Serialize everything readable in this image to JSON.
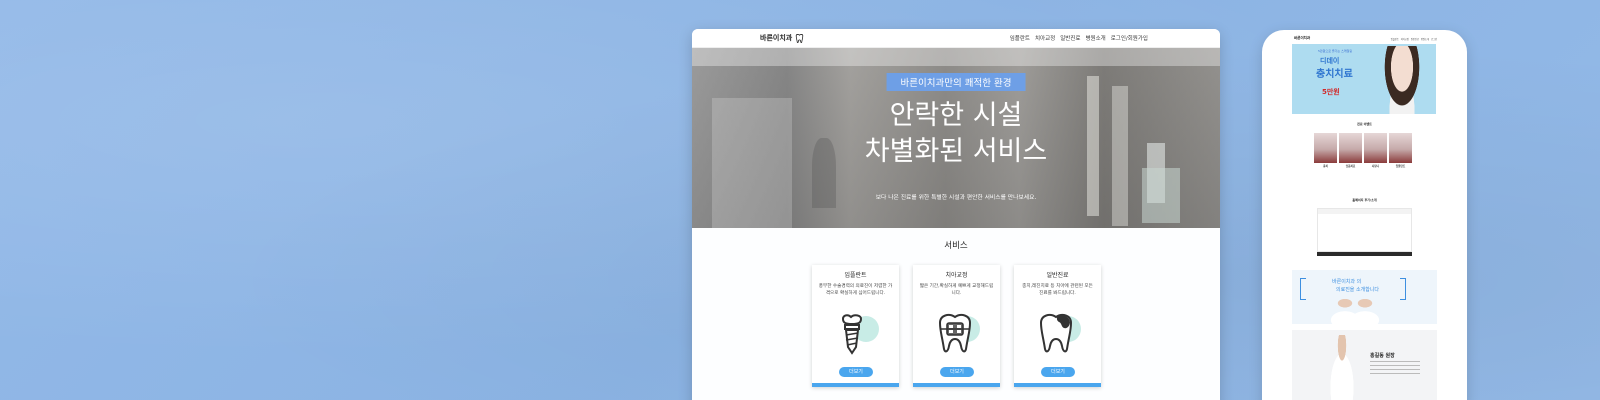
{
  "desktop": {
    "logo": "바른이치과",
    "nav": [
      "임플란트",
      "치아교정",
      "일반진료",
      "병원소개",
      "로그인/회원가입"
    ],
    "hero": {
      "badge": "바른이치과만의 쾌적한 환경",
      "title_line1": "안락한 시설",
      "title_line2": "차별화된 서비스",
      "subtitle": "보다 나은 진료를 위한 특별한 시설과 편안한 서비스를 만나보세요."
    },
    "services": {
      "title": "서비스",
      "cards": [
        {
          "name": "임플란트",
          "desc": "풍부한 수술경력의 의료진이 저렴한 가격으로 확실하게 심어드립니다.",
          "more": "더보기",
          "icon": "implant-icon"
        },
        {
          "name": "치아교정",
          "desc": "짧은 기간,확실하게 예쁘게 교정해드립니다.",
          "more": "더보기",
          "icon": "braces-tooth-icon"
        },
        {
          "name": "일반진료",
          "desc": "충치,레진치료 등 치아에 관련된 모든 진료를 봐드립니다.",
          "more": "더보기",
          "icon": "cavity-tooth-icon"
        }
      ]
    }
  },
  "mobile": {
    "logo": "바른이치과",
    "nav": [
      "임플란트",
      "치아교정",
      "일반진료",
      "병원소개",
      "로그인"
    ],
    "banner": {
      "tiny": "5만원으로 즐기는 스케일링",
      "big1": "디데이",
      "big2": "충치치료",
      "price": "5만원"
    },
    "section1_title": "진료 이벤트",
    "teeth_labels": [
      {
        "name": "충치"
      },
      {
        "name": "잇몸치료"
      },
      {
        "name": "사랑니"
      },
      {
        "name": "임플란트"
      }
    ],
    "section2_title": "홈페이지 후기/소개",
    "intro": {
      "line1": "바른이치과 의",
      "line2": "의료진을 소개합니다"
    },
    "doctor": {
      "name": "홍길동 원장"
    }
  },
  "colors": {
    "background": "#8fb6e6",
    "accent": "#4aa6ee",
    "badge": "#6e9fe6"
  }
}
